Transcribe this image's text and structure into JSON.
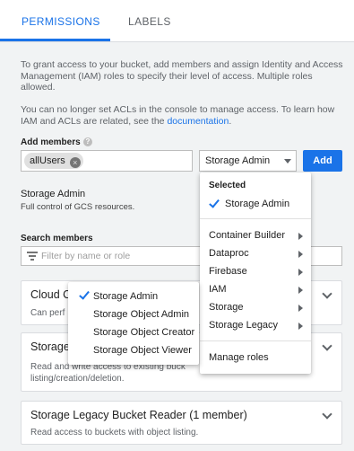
{
  "tabs": [
    {
      "label": "PERMISSIONS"
    },
    {
      "label": "LABELS"
    }
  ],
  "intro": {
    "text": "To grant access to your bucket, add members and assign Identity and Access Management (IAM) roles to specify their level of access. Multiple roles allowed.",
    "acl_text": "You can no longer set ACLs in the console to manage access. To learn how IAM and ACLs are related, see the ",
    "acl_link": "documentation",
    "acl_end": "."
  },
  "add_members": {
    "label": "Add members",
    "chip": "allUsers",
    "role_value": "Storage Admin",
    "add_label": "Add"
  },
  "role_info": {
    "title": "Storage Admin",
    "desc": "Full control of GCS resources."
  },
  "search": {
    "label": "Search members",
    "placeholder": "Filter by name or role"
  },
  "cards": [
    {
      "title": "Cloud C",
      "desc": "Can perf"
    },
    {
      "title": "Storage",
      "desc": "Read and write access to existing buck",
      "desc2": "listing/creation/deletion."
    },
    {
      "title": "Storage Legacy Bucket Reader (1 member)",
      "desc": "Read access to buckets with object listing."
    }
  ],
  "role_menu": {
    "selected_header": "Selected",
    "selected_item": "Storage Admin",
    "categories": [
      "Container Builder",
      "Dataproc",
      "Firebase",
      "IAM",
      "Storage",
      "Storage Legacy"
    ],
    "manage_label": "Manage roles"
  },
  "storage_submenu": {
    "items": [
      "Storage Admin",
      "Storage Object Admin",
      "Storage Object Creator",
      "Storage Object Viewer"
    ],
    "checked_index": 0
  },
  "colors": {
    "accent": "#1a73e8",
    "background": "#f1f3f4"
  }
}
